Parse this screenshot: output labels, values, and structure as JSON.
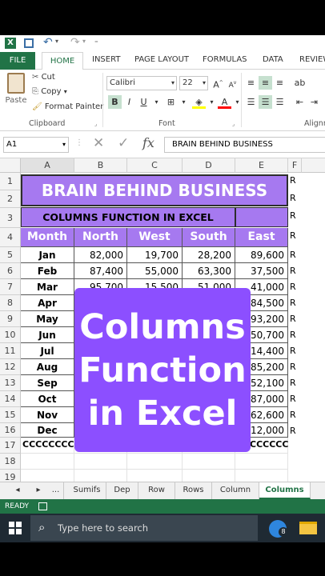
{
  "qat": {
    "excel_icon": "excel-icon",
    "save_icon": "save-icon",
    "undo_icon": "undo-icon",
    "redo_icon": "redo-icon"
  },
  "ribbon_tabs": [
    "FILE",
    "HOME",
    "INSERT",
    "PAGE LAYOUT",
    "FORMULAS",
    "DATA",
    "REVIEW"
  ],
  "clipboard": {
    "paste": "Paste",
    "cut": "Cut",
    "copy": "Copy",
    "format_painter": "Format Painter",
    "group": "Clipboard"
  },
  "font": {
    "name": "Calibri",
    "size": "22",
    "bold": "B",
    "italic": "I",
    "underline": "U",
    "group": "Font"
  },
  "alignment": {
    "group": "Alignm"
  },
  "formula_bar": {
    "name_box": "A1",
    "fx": "fx",
    "content": "BRAIN BEHIND BUSINESS"
  },
  "columns": [
    "A",
    "B",
    "C",
    "D",
    "E",
    "F"
  ],
  "rows": [
    "1",
    "2",
    "3",
    "4",
    "5",
    "6",
    "7",
    "8",
    "9",
    "10",
    "11",
    "12",
    "13",
    "14",
    "15",
    "16",
    "17",
    "18",
    "19"
  ],
  "sheet": {
    "title": "BRAIN BEHIND BUSINESS",
    "subtitle": "COLUMNS FUNCTION IN EXCEL",
    "headers": [
      "Month",
      "North",
      "West",
      "South",
      "East"
    ],
    "data": [
      [
        "Jan",
        "82,000",
        "19,700",
        "28,200",
        "89,600"
      ],
      [
        "Feb",
        "87,400",
        "55,000",
        "63,300",
        "37,500"
      ],
      [
        "Mar",
        "95,700",
        "15,500",
        "51,000",
        "41,000"
      ],
      [
        "Apr",
        "",
        "",
        "",
        "84,500"
      ],
      [
        "May",
        "",
        "",
        "",
        "93,200"
      ],
      [
        "Jun",
        "",
        "",
        "",
        "50,700"
      ],
      [
        "Jul",
        "",
        "",
        "",
        "14,400"
      ],
      [
        "Aug",
        "",
        "",
        "",
        "85,200"
      ],
      [
        "Sep",
        "",
        "",
        "",
        "52,100"
      ],
      [
        "Oct",
        "",
        "",
        "",
        "87,000"
      ],
      [
        "Nov",
        "",
        "",
        "",
        "62,600"
      ],
      [
        "Dec",
        "",
        "",
        "",
        "12,000"
      ]
    ],
    "row17_a": "CCCCCCCC",
    "row17_e": "CCCCCC",
    "f_letter": "R"
  },
  "overlay": {
    "line1": "Columns",
    "line2": "Function",
    "line3": "in Excel"
  },
  "sheet_tabs": [
    "...",
    "Sumifs",
    "Dep",
    "Row",
    "Rows",
    "Column",
    "Columns"
  ],
  "active_sheet": "Columns",
  "status": {
    "ready": "READY"
  },
  "taskbar": {
    "search_placeholder": "Type here to search",
    "badge": "8"
  },
  "colors": {
    "excel_green": "#217346",
    "purple": "#a679f0",
    "overlay": "#8c4fff"
  }
}
